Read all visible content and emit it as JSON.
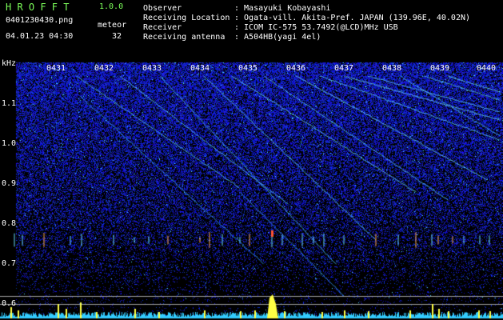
{
  "app": {
    "title": "H R O F F T",
    "version": "1.0.0",
    "filename": "0401230430.png",
    "datetime": "04.01.23 04:30",
    "meteor_label": "meteor",
    "meteor_count": "32"
  },
  "info": {
    "labels": [
      "Observer",
      "Receiving Location",
      "Receiver",
      "Receiving antenna"
    ],
    "values": [
      ": Masayuki Kobayashi",
      ": Ogata-vill. Akita-Pref. JAPAN (139.96E, 40.02N)",
      ": ICOM IC-575 53.7492(@LCD)MHz USB",
      ": A504HB(yagi 4el)"
    ]
  },
  "axis": {
    "unit": "kHz",
    "y_ticks": [
      "1.1",
      "1.0",
      "0.9",
      "0.8",
      "0.7",
      "0.6"
    ],
    "time_ticks": [
      "0431",
      "0432",
      "0433",
      "0434",
      "0435",
      "0436",
      "0437",
      "0438",
      "0439",
      "0440"
    ]
  },
  "colors": {
    "background": "#000000",
    "noise_dense": "#1a2bd0",
    "trace": "#6fe8ff",
    "header_green": "#7cff5a",
    "meteor_yellow": "#ffff44",
    "baseline_cyan": "#33ccff"
  }
}
